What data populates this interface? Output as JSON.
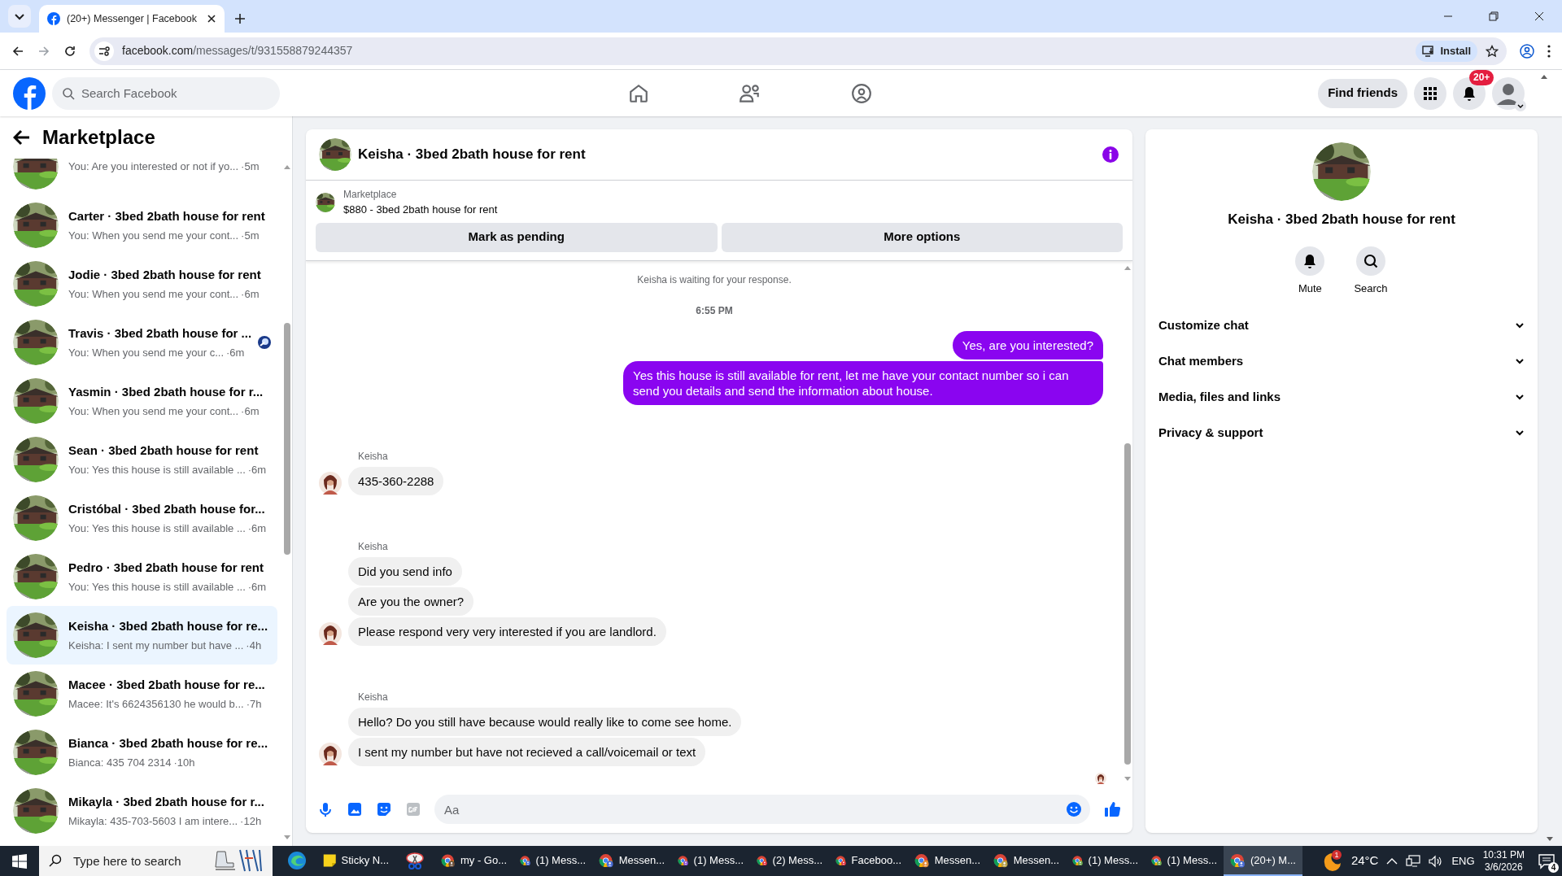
{
  "browser": {
    "tab_title": "(20+) Messenger | Facebook",
    "url_host": "facebook.com",
    "url_path": "/messages/t/931558879244357",
    "install_label": "Install"
  },
  "nav": {
    "search_placeholder": "Search Facebook",
    "find_friends": "Find friends",
    "notification_badge": "20+"
  },
  "sidebar": {
    "title": "Marketplace",
    "conversations": [
      {
        "preview": "You: Are you interested or not if yo...",
        "time": "·5m",
        "selected": false,
        "read_receipt": false
      },
      {
        "name_line": "Carter · 3bed 2bath house for rent",
        "preview": "You: When you send me your cont...",
        "time": "·5m",
        "selected": false,
        "read_receipt": false
      },
      {
        "name_line": "Jodie · 3bed 2bath house for rent",
        "preview": "You: When you send me your cont...",
        "time": "·6m",
        "selected": false,
        "read_receipt": false
      },
      {
        "name_line": "Travis · 3bed 2bath house for ...",
        "preview": "You: When you send me your c...",
        "time": "·6m",
        "selected": false,
        "read_receipt": true
      },
      {
        "name_line": "Yasmin · 3bed 2bath house for r...",
        "preview": "You: When you send me your cont...",
        "time": "·6m",
        "selected": false,
        "read_receipt": false
      },
      {
        "name_line": "Sean · 3bed 2bath house for rent",
        "preview": "You: Yes this house is still available ...",
        "time": "·6m",
        "selected": false,
        "read_receipt": false
      },
      {
        "name_line": "Cristóbal · 3bed 2bath house for...",
        "preview": "You: Yes this house is still available ...",
        "time": "·6m",
        "selected": false,
        "read_receipt": false
      },
      {
        "name_line": "Pedro · 3bed 2bath house for rent",
        "preview": "You: Yes this house is still available ...",
        "time": "·6m",
        "selected": false,
        "read_receipt": false
      },
      {
        "name_line": "Keisha · 3bed 2bath house for re...",
        "preview": "Keisha: I sent my number but have ...",
        "time": "·4h",
        "selected": true,
        "read_receipt": false
      },
      {
        "name_line": "Macee · 3bed 2bath house for re...",
        "preview": "Macee: It's 6624356130 he would b...",
        "time": "·7h",
        "selected": false,
        "read_receipt": false
      },
      {
        "name_line": "Bianca · 3bed 2bath house for re...",
        "preview": "Bianca: 435 704 2314",
        "time": "·10h",
        "selected": false,
        "read_receipt": false
      },
      {
        "name_line": "Mikayla · 3bed 2bath house for r...",
        "preview": "Mikayla: 435-703-5603 I am intere...",
        "time": "·12h",
        "selected": false,
        "read_receipt": false
      }
    ]
  },
  "chat": {
    "title": "Keisha · 3bed 2bath house for rent",
    "listing": {
      "source": "Marketplace",
      "price_title": "$880 - 3bed 2bath house for rent"
    },
    "buttons": [
      "Mark as pending",
      "More options"
    ],
    "messages": [
      {
        "kind": "notice",
        "text": "Keisha is waiting for your response."
      },
      {
        "kind": "time",
        "text": "6:55 PM"
      },
      {
        "kind": "sent",
        "texts": [
          "Yes, are you interested?",
          "Yes this house is still available for rent, let me have your contact number so i can send you details and send the information about house."
        ]
      },
      {
        "kind": "received",
        "sender": "Keisha",
        "texts": [
          "435-360-2288"
        ]
      },
      {
        "kind": "received",
        "sender": "Keisha",
        "texts": [
          "Did you send info",
          "Are you the owner?",
          "Please respond very very interested if you are landlord."
        ]
      },
      {
        "kind": "received",
        "sender": "Keisha",
        "texts": [
          "Hello? Do you still have because would really like to come see home.",
          "I sent my number but have not recieved a call/voicemail or text"
        ]
      }
    ],
    "composer_placeholder": "Aa"
  },
  "details": {
    "name": "Keisha · 3bed 2bath house for rent",
    "actions": [
      {
        "kind": "mute",
        "label": "Mute"
      },
      {
        "kind": "search",
        "label": "Search"
      }
    ],
    "sections": [
      "Customize chat",
      "Chat members",
      "Media, files and links",
      "Privacy & support"
    ]
  },
  "taskbar": {
    "search_placeholder": "Type here to search",
    "apps": [
      {
        "kind": "edge",
        "selected": false
      },
      {
        "kind": "sticky",
        "label": "Sticky N...",
        "selected": false
      },
      {
        "kind": "snip",
        "selected": false
      },
      {
        "kind": "chrome",
        "label": "my - Go...",
        "color": "#6b4f3a",
        "selected": false
      },
      {
        "kind": "chrome",
        "label": "(1) Mess...",
        "color": "#4a6cd4",
        "selected": false
      },
      {
        "kind": "chrome",
        "label": "Messen...",
        "color": "#4a6cd4",
        "selected": false
      },
      {
        "kind": "chrome",
        "label": "(1) Mess...",
        "color": "#8b4fd6",
        "selected": false
      },
      {
        "kind": "chrome",
        "label": "(2) Mess...",
        "color": "#e0323f",
        "selected": false
      },
      {
        "kind": "chrome",
        "label": "Faceboo...",
        "color": "#e0323f",
        "selected": false
      },
      {
        "kind": "chrome",
        "label": "Messen...",
        "color": "#e08a3a",
        "selected": false
      },
      {
        "kind": "chrome",
        "label": "Messen...",
        "color": "#b5a24a",
        "selected": false
      },
      {
        "kind": "chrome",
        "label": "(1) Mess...",
        "color": "#6aa84f",
        "selected": false
      },
      {
        "kind": "chrome",
        "label": "(1) Mess...",
        "color": "#6aa84f",
        "selected": false
      },
      {
        "kind": "chrome",
        "label": "(20+) M...",
        "color": "#4a6cd4",
        "selected": true
      }
    ],
    "weather_badge": "1",
    "temperature": "24°C",
    "language": "ENG",
    "time": "10:31 PM",
    "date": "3/6/2026",
    "notification_count": "4"
  }
}
